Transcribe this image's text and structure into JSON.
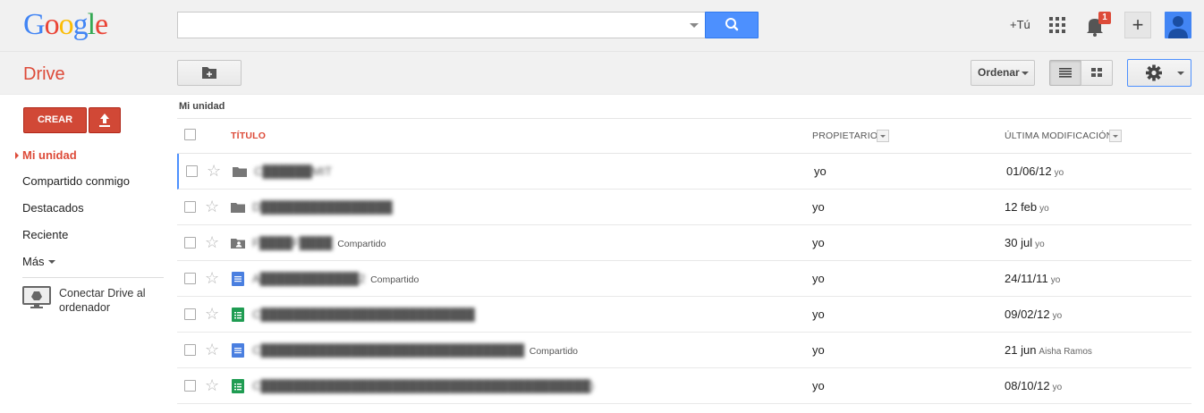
{
  "header": {
    "logo_letters": [
      {
        "ch": "G",
        "color": "#4285f4"
      },
      {
        "ch": "o",
        "color": "#ea4335"
      },
      {
        "ch": "o",
        "color": "#fbbc05"
      },
      {
        "ch": "g",
        "color": "#4285f4"
      },
      {
        "ch": "l",
        "color": "#34a853"
      },
      {
        "ch": "e",
        "color": "#ea4335"
      }
    ],
    "search_value": "",
    "plus_user": "+Tú",
    "notification_count": "1"
  },
  "toolbar": {
    "app_title": "Drive",
    "sort_label": "Ordenar"
  },
  "sidebar": {
    "create_label": "CREAR",
    "items": [
      {
        "label": "Mi unidad",
        "active": true
      },
      {
        "label": "Compartido conmigo",
        "active": false
      },
      {
        "label": "Destacados",
        "active": false
      },
      {
        "label": "Reciente",
        "active": false
      },
      {
        "label": "Más",
        "active": false
      }
    ],
    "connect_label": "Conectar Drive al ordenador"
  },
  "main": {
    "breadcrumb": "Mi unidad",
    "columns": {
      "title": "TÍTULO",
      "owner": "PROPIETARIO",
      "modified": "ÚLTIMA MODIFICACIÓN"
    },
    "rows": [
      {
        "type": "folder",
        "name": "C██████MIT",
        "shared": "",
        "owner": "yo",
        "date": "01/06/12",
        "by": "yo",
        "selected": true
      },
      {
        "type": "folder",
        "name": "D████████████████",
        "shared": "",
        "owner": "yo",
        "date": "12 feb",
        "by": "yo",
        "selected": false
      },
      {
        "type": "shared-folder",
        "name": "F████F████",
        "shared": "Compartido",
        "owner": "yo",
        "date": "30 jul",
        "by": "yo",
        "selected": false
      },
      {
        "type": "doc",
        "name": "A████████████2",
        "shared": "Compartido",
        "owner": "yo",
        "date": "24/11/11",
        "by": "yo",
        "selected": false
      },
      {
        "type": "sheet",
        "name": "C██████████████████████████",
        "shared": "",
        "owner": "yo",
        "date": "09/02/12",
        "by": "yo",
        "selected": false
      },
      {
        "type": "doc",
        "name": "C████████████████████████████████",
        "shared": "Compartido",
        "owner": "yo",
        "date": "21 jun",
        "by": "Aisha Ramos",
        "selected": false
      },
      {
        "type": "sheet",
        "name": "C████████████████████████████████████████)",
        "shared": "",
        "owner": "yo",
        "date": "08/10/12",
        "by": "yo",
        "selected": false
      }
    ]
  }
}
